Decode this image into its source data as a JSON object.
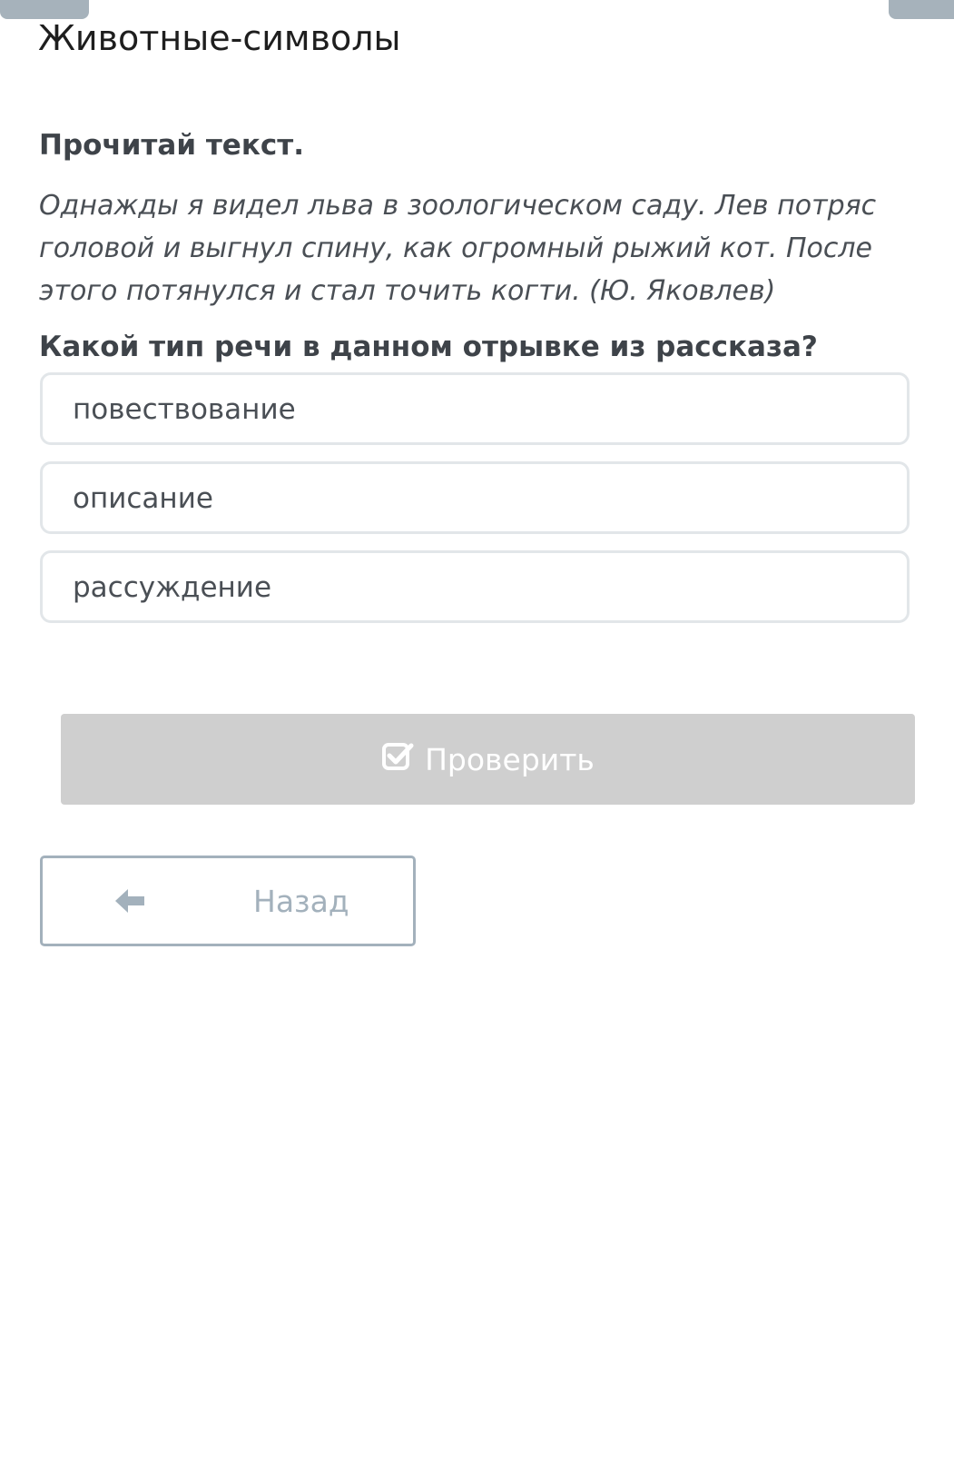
{
  "header": {
    "title": "Животные-символы"
  },
  "task": {
    "instruction": "Прочитай текст.",
    "passage_lines": [
      "Однажды я видел льва в зоологическом саду. Лев потряс",
      "головой и выгнул спину, как огромный рыжий кот. После",
      "этого потянулся и стал точить когти. (Ю. Яковлев)"
    ],
    "question": "Какой тип речи в данном отрывке из рассказа?"
  },
  "options": [
    {
      "label": "повествование"
    },
    {
      "label": "описание"
    },
    {
      "label": "рассуждение"
    }
  ],
  "actions": {
    "check_label": "Проверить",
    "check_icon": "check-square-icon",
    "back_label": "Назад",
    "back_icon": "arrow-left-icon"
  },
  "colors": {
    "check_button_bg": "#cfcfcf",
    "back_button_border": "#a3b1bc",
    "option_border": "#e2e6e9",
    "top_tab": "#a6b2bb"
  }
}
